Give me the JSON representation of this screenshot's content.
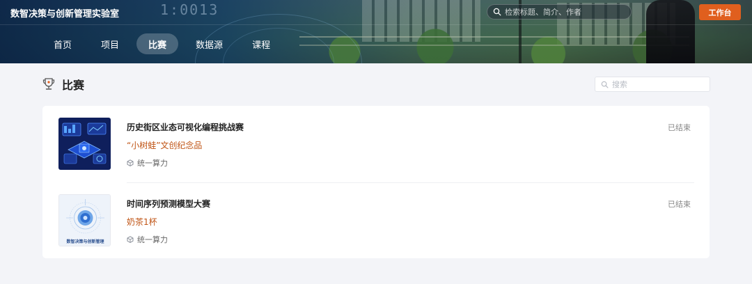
{
  "app": {
    "site_title": "数智决策与创新管理实验室",
    "top_search_placeholder": "检索标题、简介、作者",
    "workbench_label": "工作台",
    "banner_clock": "1:0013"
  },
  "nav": {
    "items": [
      {
        "label": "首页"
      },
      {
        "label": "项目"
      },
      {
        "label": "比赛",
        "active": true
      },
      {
        "label": "数据源"
      },
      {
        "label": "课程"
      }
    ]
  },
  "section": {
    "title": "比赛",
    "icon": "trophy-icon",
    "search_placeholder": "搜索"
  },
  "competitions": [
    {
      "title": "历史街区业态可视化编程挑战赛",
      "prize": "“小树蛙”文创纪念品",
      "organizer": "统一算力",
      "status": "已结束",
      "thumb_icon": "dashboard-illustration"
    },
    {
      "title": "时间序列预测模型大赛",
      "prize": "奶茶1杯",
      "organizer": "统一算力",
      "status": "已结束",
      "thumb_icon": "lab-logo-illustration",
      "thumb_caption": "数智决策与创新管理"
    }
  ],
  "colors": {
    "accent_orange": "#e05f1e",
    "prize_text": "#c05415",
    "page_bg": "#f3f4f8"
  }
}
